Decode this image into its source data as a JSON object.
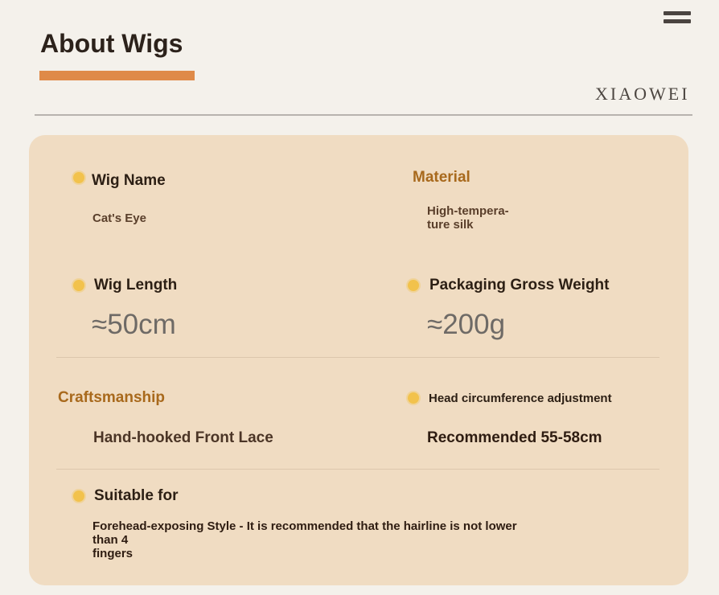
{
  "header": {
    "title": "About Wigs",
    "brand": "XIAOWEI"
  },
  "specs": {
    "wig_name": {
      "label": "Wig Name",
      "value": "Cat's Eye"
    },
    "material": {
      "label": "Material",
      "value_line1": "High-tempera-",
      "value_line2": "ture silk"
    },
    "wig_length": {
      "label": "Wig Length",
      "value": "≈50cm"
    },
    "gross_weight": {
      "label": "Packaging Gross Weight",
      "value": "≈200g"
    },
    "craftsmanship": {
      "label": "Craftsmanship",
      "value": "Hand-hooked Front Lace"
    },
    "head_circumference": {
      "label": "Head circumference adjustment",
      "value": "Recommended 55-58cm"
    },
    "suitable_for": {
      "label": "Suitable for",
      "value_line1": "Forehead-exposing Style - It is recommended that the hairline is not lower than 4",
      "value_line2": "fingers"
    }
  },
  "colors": {
    "accent_underline": "#df8a48",
    "card_background": "#f0dcc2",
    "bullet_dot": "#f2c24c",
    "gold_label": "#a8691c"
  },
  "icons": {
    "menu": "hamburger-menu-icon",
    "bullet": "bullet-dot-icon"
  }
}
